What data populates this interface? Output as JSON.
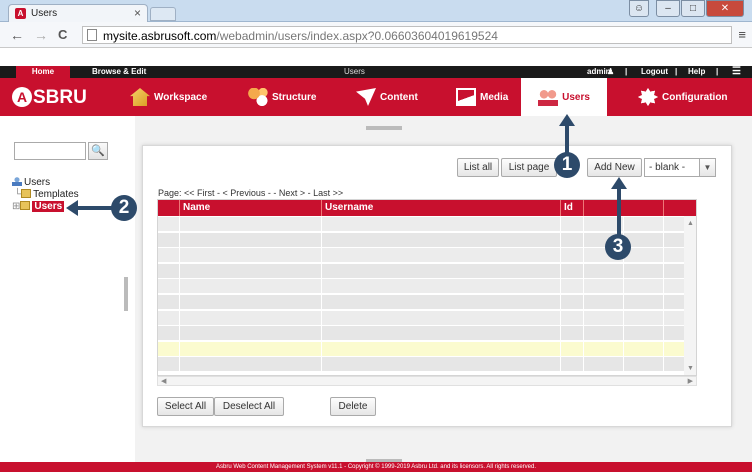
{
  "browser": {
    "tab_title": "Users",
    "tab_close": "×",
    "url_host": "mysite.asbrusoft.com",
    "url_path": "/webadmin/users/index.aspx?0.06603604019619524",
    "back": "←",
    "forward": "→",
    "reload": "C",
    "menu": "≡"
  },
  "header_top": {
    "home": "Home",
    "browse_edit": "Browse & Edit",
    "section": "Users",
    "user": "admin",
    "sep1": "|",
    "logout": "Logout",
    "sep2": "|",
    "help": "Help",
    "sep3": "|",
    "menu": "☰"
  },
  "logo": {
    "a": "A",
    "text": "SBRU"
  },
  "mainnav": {
    "workspace": "Workspace",
    "structure": "Structure",
    "content": "Content",
    "media": "Media",
    "users": "Users",
    "configuration": "Configuration"
  },
  "sidebar": {
    "search_placeholder": "",
    "search_icon": "🔍",
    "tree": {
      "root": "Users",
      "templates": "Templates",
      "users": "Users"
    }
  },
  "toolbar": {
    "list_all": "List all",
    "list_page": "List page",
    "add_new": "Add New",
    "template_select": "- blank -",
    "select_arrow": "▼"
  },
  "pager": {
    "page_label": "Page:",
    "links": "<< First - < Previous - - Next > - Last >>"
  },
  "grid": {
    "columns": [
      "",
      "Name",
      "Username",
      "Id",
      "",
      ""
    ],
    "row_count": 10,
    "highlighted_row": 8
  },
  "actions": {
    "select_all": "Select All",
    "deselect_all": "Deselect All",
    "delete": "Delete"
  },
  "footer": {
    "text": "Asbru Web Content Management System v11.1 - Copyright © 1999-2019 Asbru Ltd. and its licensors. All rights reserved."
  },
  "callouts": {
    "one": "1",
    "two": "2",
    "three": "3"
  },
  "colors": {
    "brand_red": "#c8102e",
    "callout": "#2d4a6a"
  }
}
